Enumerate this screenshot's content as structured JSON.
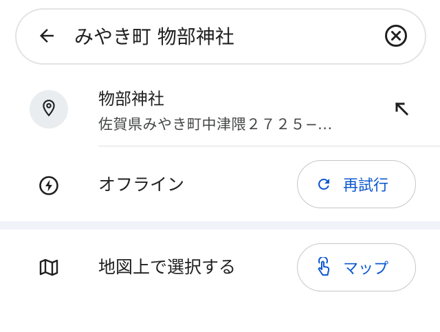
{
  "search": {
    "query": "みやき町 物部神社",
    "back_icon": "arrow-back-icon",
    "clear_icon": "clear-circle-icon"
  },
  "suggestion": {
    "name": "物部神社",
    "address": "佐賀県みやき町中津隈２７２５−...",
    "icon": "place-pin-icon",
    "fill_icon": "arrow-north-west-icon"
  },
  "offline": {
    "label": "オフライン",
    "icon": "offline-bolt-icon",
    "retry_label": "再試行",
    "retry_icon": "refresh-icon"
  },
  "map_select": {
    "label": "地図上で選択する",
    "icon": "map-icon",
    "button_label": "マップ",
    "button_icon": "touch-icon"
  },
  "colors": {
    "accent": "#0b57d0",
    "text_primary": "#1f1f1f",
    "text_secondary": "#444746",
    "icon_bg": "#eaedf0",
    "section_divider": "#f0f3f8"
  }
}
